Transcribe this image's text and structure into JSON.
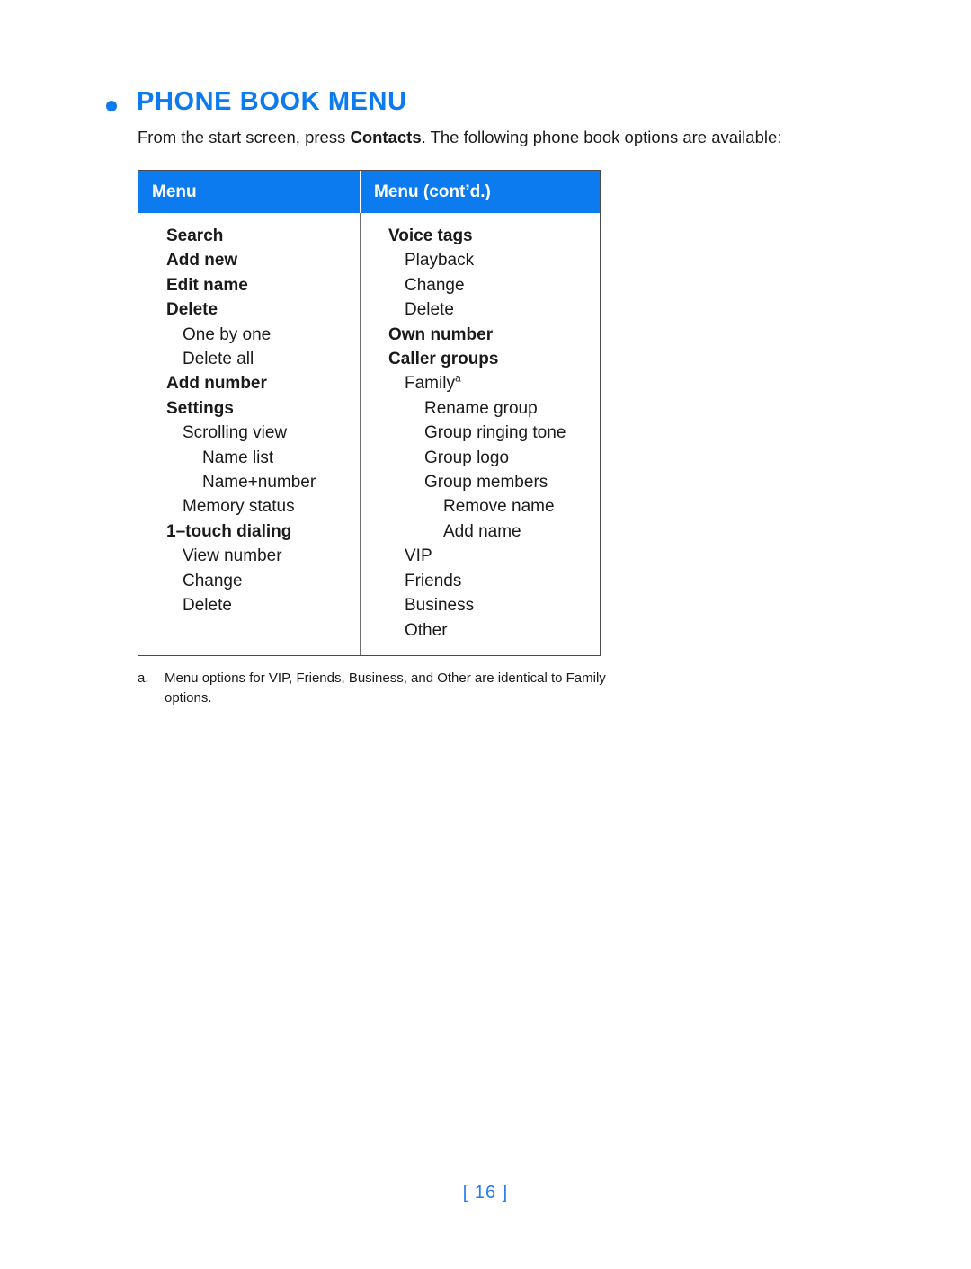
{
  "heading": {
    "bullet": "bullet-dot",
    "title": "PHONE BOOK MENU"
  },
  "intro": {
    "before": "From the start screen, press ",
    "bold": "Contacts",
    "after": ". The following phone book options are available:"
  },
  "table": {
    "headers": {
      "col_a": "Menu",
      "col_b": "Menu (cont’d.)"
    },
    "column_a": [
      {
        "label": "Search",
        "level": 0,
        "bold": true
      },
      {
        "label": "Add new",
        "level": 0,
        "bold": true
      },
      {
        "label": "Edit name",
        "level": 0,
        "bold": true
      },
      {
        "label": "Delete",
        "level": 0,
        "bold": true
      },
      {
        "label": "One by one",
        "level": 1,
        "bold": false
      },
      {
        "label": "Delete all",
        "level": 1,
        "bold": false
      },
      {
        "label": "Add number",
        "level": 0,
        "bold": true
      },
      {
        "label": "Settings",
        "level": 0,
        "bold": true
      },
      {
        "label": "Scrolling view",
        "level": 1,
        "bold": false
      },
      {
        "label": "Name list",
        "level": 2,
        "bold": false
      },
      {
        "label": "Name+number",
        "level": 2,
        "bold": false
      },
      {
        "label": "Memory status",
        "level": 1,
        "bold": false
      },
      {
        "label": "1–touch dialing",
        "level": 0,
        "bold": true
      },
      {
        "label": "View number",
        "level": 1,
        "bold": false
      },
      {
        "label": "Change",
        "level": 1,
        "bold": false
      },
      {
        "label": "Delete",
        "level": 1,
        "bold": false
      }
    ],
    "column_b": [
      {
        "label": "Voice tags",
        "level": 0,
        "bold": true
      },
      {
        "label": "Playback",
        "level": 1,
        "bold": false
      },
      {
        "label": "Change",
        "level": 1,
        "bold": false
      },
      {
        "label": "Delete",
        "level": 1,
        "bold": false
      },
      {
        "label": "Own number",
        "level": 0,
        "bold": true
      },
      {
        "label": "Caller groups",
        "level": 0,
        "bold": true
      },
      {
        "label": "Family",
        "level": 1,
        "bold": false,
        "footnote": "a"
      },
      {
        "label": "Rename group",
        "level": 2,
        "bold": false
      },
      {
        "label": "Group ringing tone",
        "level": 2,
        "bold": false
      },
      {
        "label": "Group logo",
        "level": 2,
        "bold": false
      },
      {
        "label": "Group members",
        "level": 2,
        "bold": false
      },
      {
        "label": "Remove name",
        "level": 3,
        "bold": false
      },
      {
        "label": "Add name",
        "level": 3,
        "bold": false
      },
      {
        "label": "VIP",
        "level": 1,
        "bold": false
      },
      {
        "label": "Friends",
        "level": 1,
        "bold": false
      },
      {
        "label": "Business",
        "level": 1,
        "bold": false
      },
      {
        "label": "Other",
        "level": 1,
        "bold": false
      }
    ]
  },
  "footnote": {
    "marker": "a.",
    "text": "Menu options for VIP, Friends, Business, and Other are identical to Family options."
  },
  "page_number": "[ 16 ]",
  "colors": {
    "accent_blue": "#0d7bf0",
    "page_number_blue": "#1f7ef0",
    "table_border": "#4a4a4a",
    "text": "#1a1a1a"
  }
}
